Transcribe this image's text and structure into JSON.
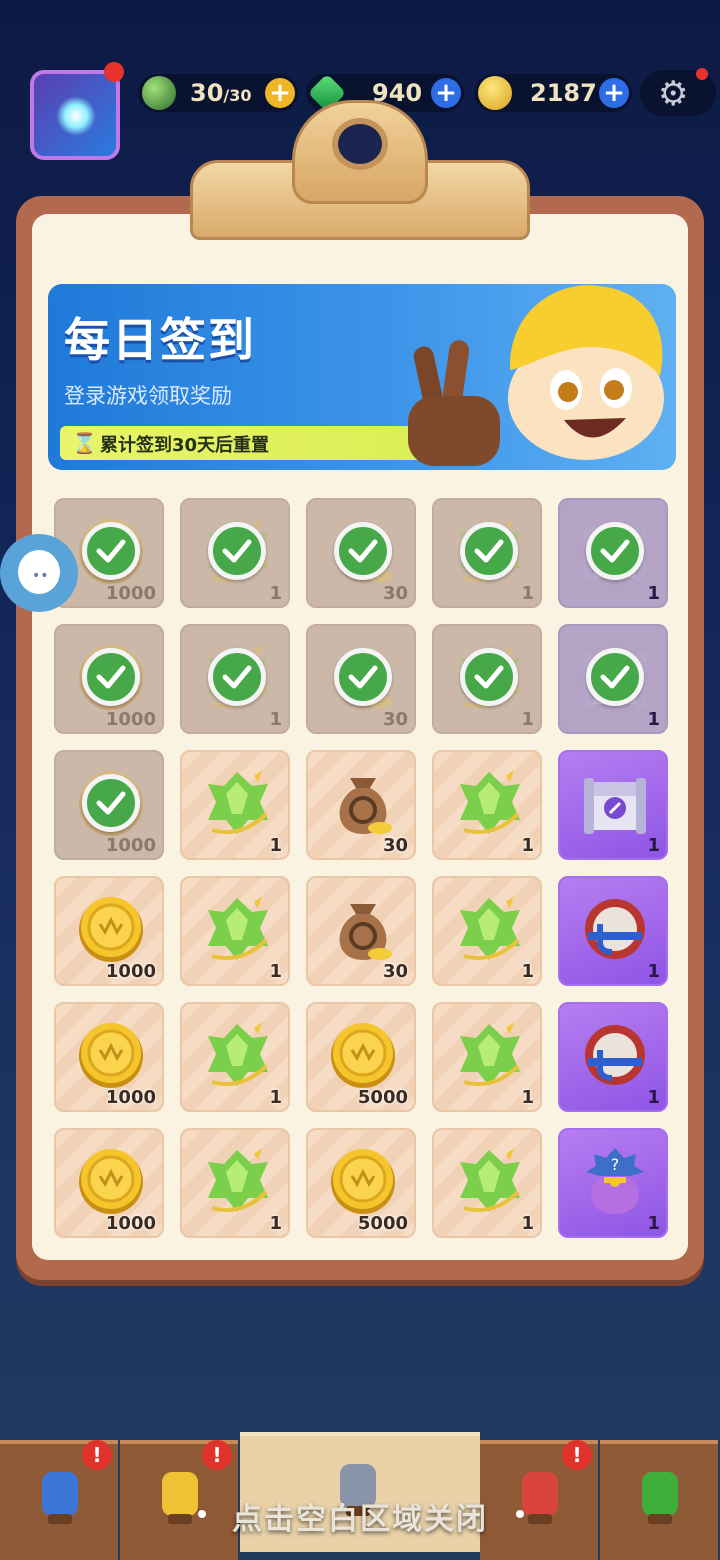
{
  "resources": {
    "stamina": {
      "value": "30",
      "max": "/30",
      "icon": "green-orb-icon"
    },
    "gems": {
      "value": "940",
      "icon": "green-gem-icon"
    },
    "coins": {
      "value": "2187",
      "icon": "gold-coin-icon"
    },
    "plus": "+"
  },
  "banner": {
    "title": "每日签到",
    "subtitle": "登录游戏领取奖励",
    "reset_note": "累计签到30天后重置",
    "hourglass": "⌛"
  },
  "rewards": [
    {
      "qty": "1000",
      "icon": "gold-coin-icon",
      "claimed": true
    },
    {
      "qty": "1",
      "icon": "green-crystal-icon",
      "claimed": true
    },
    {
      "qty": "30",
      "icon": "money-bag-icon",
      "claimed": true
    },
    {
      "qty": "1",
      "icon": "green-crystal-icon",
      "claimed": true
    },
    {
      "qty": "1",
      "icon": "chest-icon",
      "claimed": true,
      "purple": true
    },
    {
      "qty": "1000",
      "icon": "gold-coin-icon",
      "claimed": true
    },
    {
      "qty": "1",
      "icon": "green-crystal-icon",
      "claimed": true
    },
    {
      "qty": "30",
      "icon": "money-bag-icon",
      "claimed": true
    },
    {
      "qty": "1",
      "icon": "green-crystal-icon",
      "claimed": true
    },
    {
      "qty": "1",
      "icon": "chest-icon",
      "claimed": true,
      "purple": true
    },
    {
      "qty": "1000",
      "icon": "gold-coin-icon",
      "claimed": true
    },
    {
      "qty": "1",
      "icon": "green-crystal-icon",
      "claimed": false
    },
    {
      "qty": "30",
      "icon": "money-bag-icon",
      "claimed": false
    },
    {
      "qty": "1",
      "icon": "green-crystal-icon",
      "claimed": false
    },
    {
      "qty": "1",
      "icon": "chest-icon",
      "claimed": false,
      "purple": true
    },
    {
      "qty": "1000",
      "icon": "gold-coin-icon",
      "claimed": false
    },
    {
      "qty": "1",
      "icon": "green-crystal-icon",
      "claimed": false
    },
    {
      "qty": "30",
      "icon": "money-bag-icon",
      "claimed": false
    },
    {
      "qty": "1",
      "icon": "green-crystal-icon",
      "claimed": false
    },
    {
      "qty": "1",
      "icon": "magnet-icon",
      "claimed": false,
      "purple": true
    },
    {
      "qty": "1000",
      "icon": "gold-coin-icon",
      "claimed": false
    },
    {
      "qty": "1",
      "icon": "green-crystal-icon",
      "claimed": false
    },
    {
      "qty": "5000",
      "icon": "gold-coin-icon",
      "claimed": false
    },
    {
      "qty": "1",
      "icon": "green-crystal-icon",
      "claimed": false
    },
    {
      "qty": "1",
      "icon": "magnet-icon",
      "claimed": false,
      "purple": true
    },
    {
      "qty": "1000",
      "icon": "gold-coin-icon",
      "claimed": false
    },
    {
      "qty": "1",
      "icon": "green-crystal-icon",
      "claimed": false
    },
    {
      "qty": "5000",
      "icon": "gold-coin-icon",
      "claimed": false
    },
    {
      "qty": "1",
      "icon": "green-crystal-icon",
      "claimed": false
    },
    {
      "qty": "1",
      "icon": "mystery-bag-icon",
      "claimed": false,
      "purple": true
    }
  ],
  "nav": {
    "badge": "!",
    "tabs": [
      {
        "icon": "shop-icon",
        "badge": true
      },
      {
        "icon": "hero-icon",
        "badge": true
      },
      {
        "icon": "battle-icon",
        "badge": false,
        "active": true
      },
      {
        "icon": "target-icon",
        "badge": true
      },
      {
        "icon": "upgrade-arrow-icon",
        "badge": false
      }
    ]
  },
  "close_hint": "点击空白区域关闭",
  "colors": {
    "accent_blue": "#2f6de6",
    "check_green": "#47a84a",
    "board_brown": "#b3694e",
    "purple_cell": "#9a62ea"
  }
}
